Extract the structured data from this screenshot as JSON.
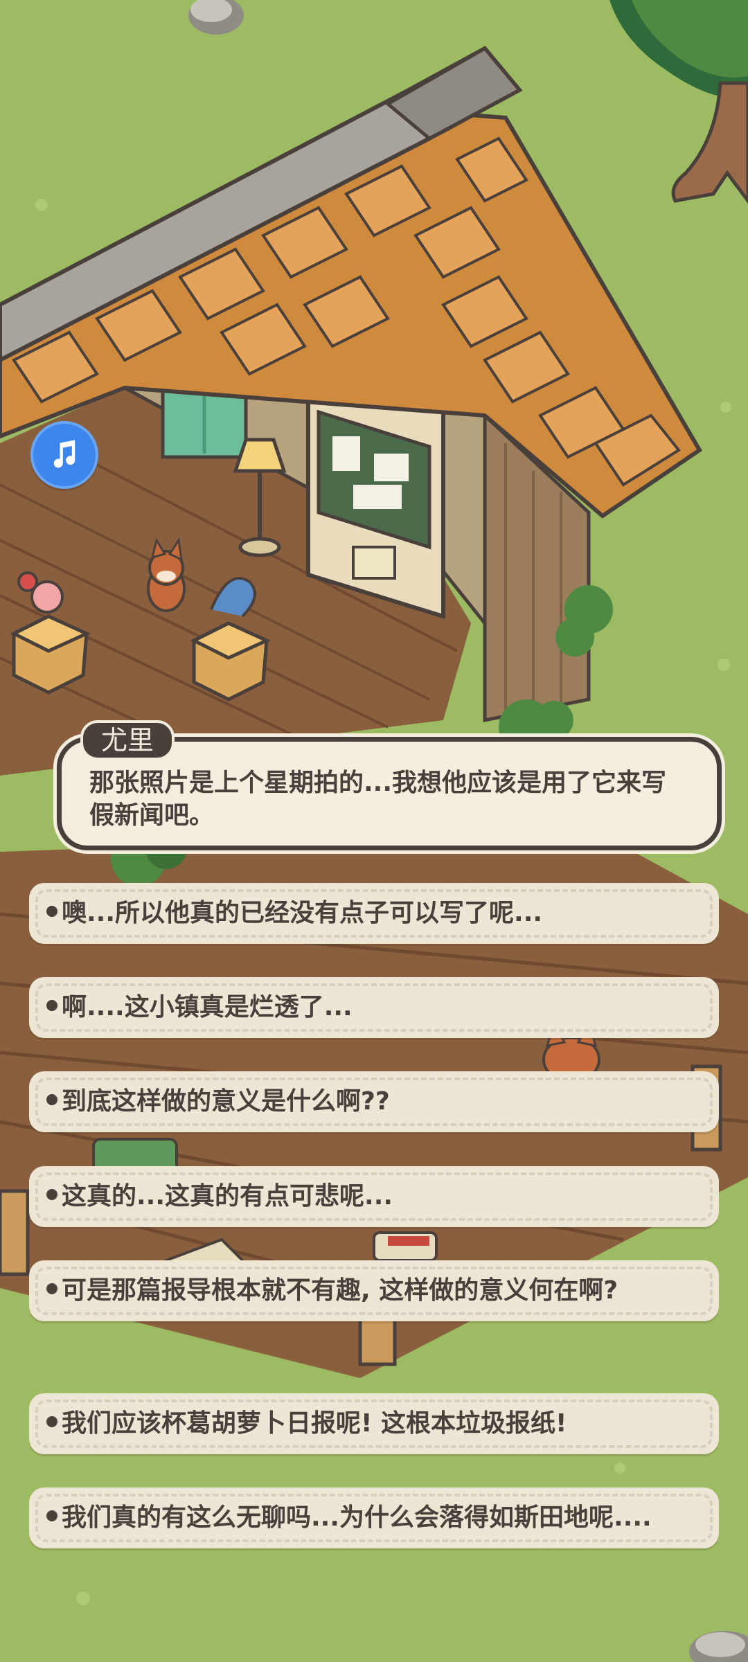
{
  "music_button": {
    "icon": "music-note-icon",
    "color": "#3d86ee"
  },
  "dialog": {
    "speaker": "尤里",
    "text": "那张照片是上个星期拍的...我想他应该是用了它来写假新闻吧。"
  },
  "choices": [
    {
      "text": "噢...所以他真的已经没有点子可以写了呢..."
    },
    {
      "text": "啊....这小镇真是烂透了..."
    },
    {
      "text": "到底这样做的意义是什么啊??"
    },
    {
      "text": "这真的...这真的有点可悲呢..."
    },
    {
      "text": "可是那篇报导根本就不有趣, 这样做的意义何在啊?"
    },
    {
      "text": "我们应该杯葛胡萝卜日报呢! 这根本垃圾报纸!"
    },
    {
      "text": "我们真的有这么无聊吗...为什么会落得如斯田地呢...."
    }
  ]
}
